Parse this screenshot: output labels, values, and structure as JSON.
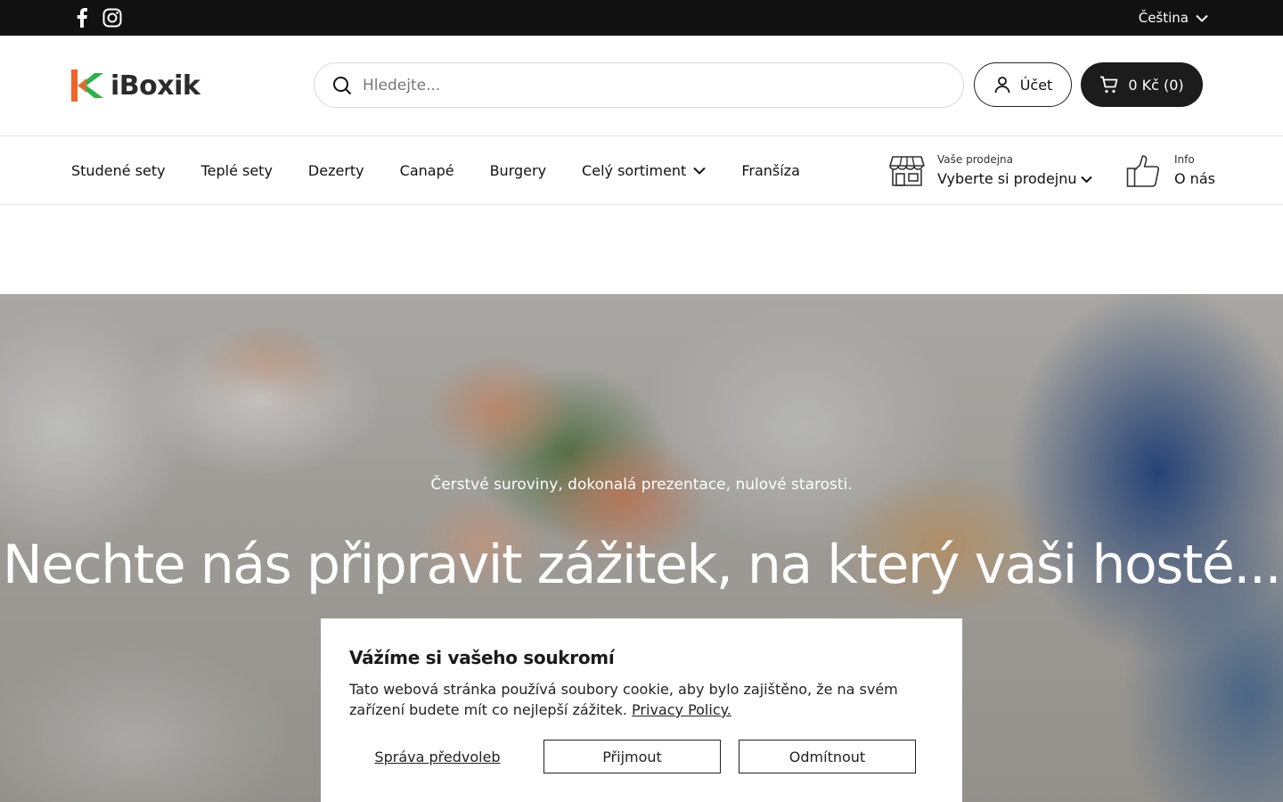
{
  "topbar": {
    "language": "Čeština",
    "social": {
      "facebook_icon": "facebook-icon",
      "instagram_icon": "instagram-icon"
    }
  },
  "header": {
    "logo_text": "iBoxik",
    "search": {
      "placeholder": "Hledejte..."
    },
    "account_label": "Účet",
    "cart_label": "0 Kč (0)"
  },
  "nav": {
    "items": [
      {
        "label": "Studené sety"
      },
      {
        "label": "Teplé sety"
      },
      {
        "label": "Dezerty"
      },
      {
        "label": "Canapé"
      },
      {
        "label": "Burgery"
      },
      {
        "label": "Celý sortiment"
      },
      {
        "label": "Franšíza"
      }
    ],
    "store": {
      "small": "Vaše prodejna",
      "big": "Vyberte si prodejnu"
    },
    "info": {
      "small": "Info",
      "big": "O nás"
    }
  },
  "hero": {
    "subtitle": "Čerstvé suroviny, dokonalá prezentace, nulové starosti.",
    "title": "Nechte nás připravit zážitek, na který vaši hosté..."
  },
  "cookie": {
    "title": "Vážíme si vašeho soukromí",
    "text": "Tato webová stránka používá soubory cookie, aby bylo zajištěno, že na svém zařízení budete mít co nejlepší zážitek. ",
    "link": "Privacy Policy.",
    "manage": "Správa předvoleb",
    "accept": "Přijmout",
    "reject": "Odmítnout"
  },
  "colors": {
    "topbar_bg": "#111111",
    "cart_bg": "#1c1c1c",
    "logo_orange": "#f0642a",
    "logo_green": "#2db14a"
  }
}
